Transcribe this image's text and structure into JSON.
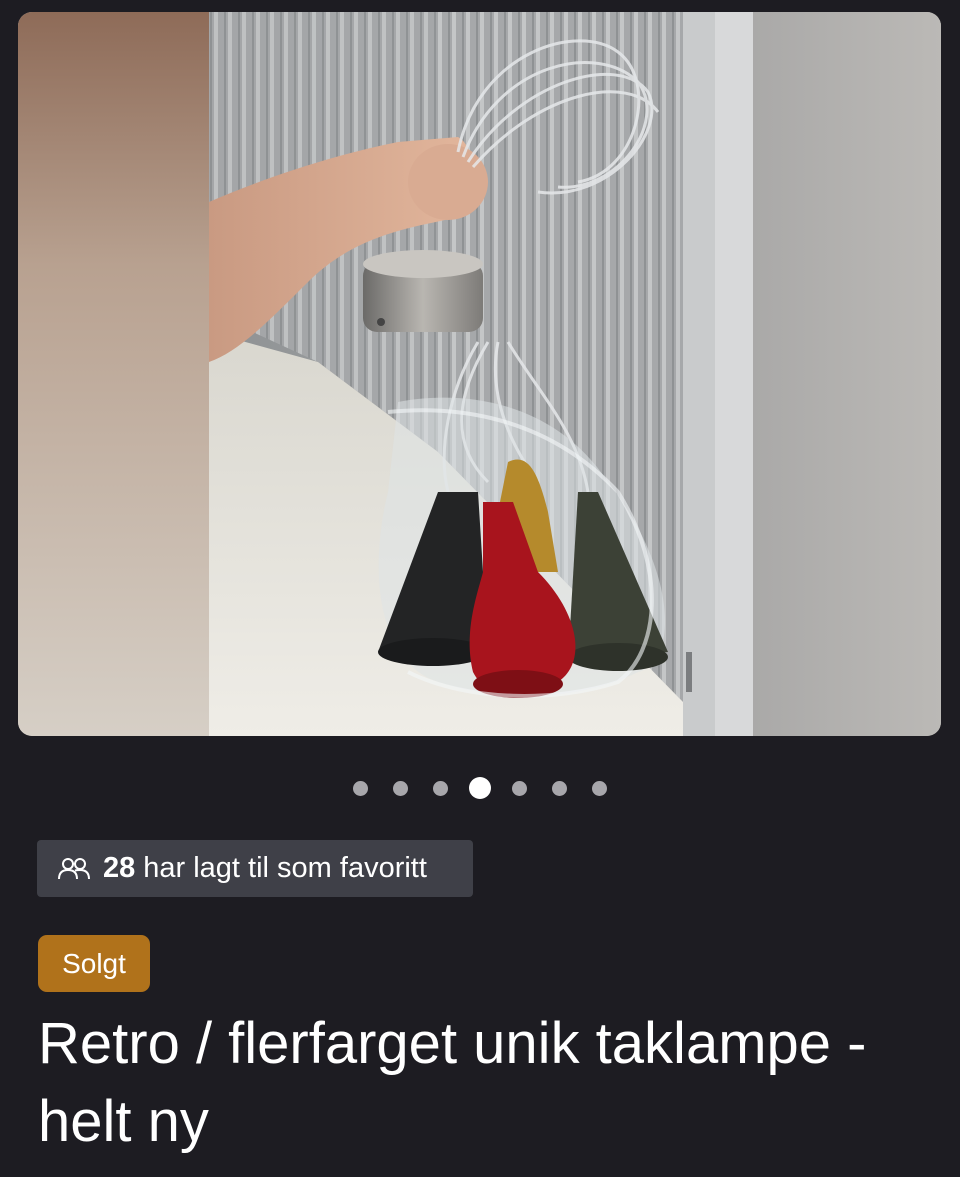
{
  "gallery": {
    "image_alt": "Taklampe med flere fargede skjermer i plast, holdt i hånden",
    "dots_count": 7,
    "active_index": 3
  },
  "favorites": {
    "count": "28",
    "text": "har lagt til som favoritt",
    "icon": "users-icon"
  },
  "listing": {
    "status": "Solgt",
    "title": "Retro / flerfarget unik taklampe - helt ny"
  },
  "colors": {
    "background": "#1d1c22",
    "chip_background": "#3f4048",
    "status_badge": "#b0721b",
    "dot_inactive": "#a7a6ab",
    "dot_active": "#ffffff"
  }
}
